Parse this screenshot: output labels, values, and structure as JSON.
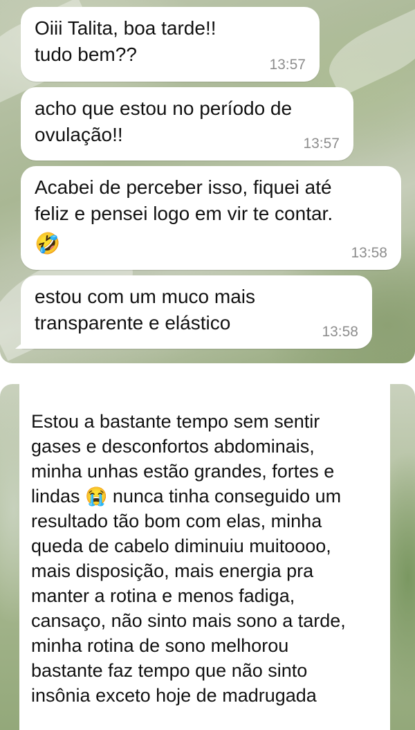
{
  "chat_top": {
    "messages": [
      {
        "text": "Oiii Talita, boa tarde!!\ntudo bem??",
        "time": "13:57"
      },
      {
        "text": "acho que estou no período de\novulação!!",
        "time": "13:57"
      },
      {
        "text": "Acabei de perceber isso, fiquei até\nfeliz e pensei logo em vir te contar.",
        "emoji": "🤣",
        "time": "13:58"
      },
      {
        "text": "estou com um muco mais\ntransparente e elástico",
        "time": "13:58"
      }
    ]
  },
  "chat_bottom": {
    "message_part1": "Estou a bastante tempo sem sentir\ngases e desconfortos abdominais,\nminha unhas estão grandes, fortes e\nlindas ",
    "emoji": "😭",
    "message_part2": " nunca tinha conseguido um\nresultado tão bom com elas, minha\nqueda de cabelo diminuiu muitoooo,\nmais disposição, mais energia pra\nmanter a rotina e menos fadiga,\ncansaço, não sinto mais sono a tarde,\nminha rotina de sono melhorou\nbastante faz tempo que não sinto\ninsônia exceto hoje de madrugada"
  }
}
